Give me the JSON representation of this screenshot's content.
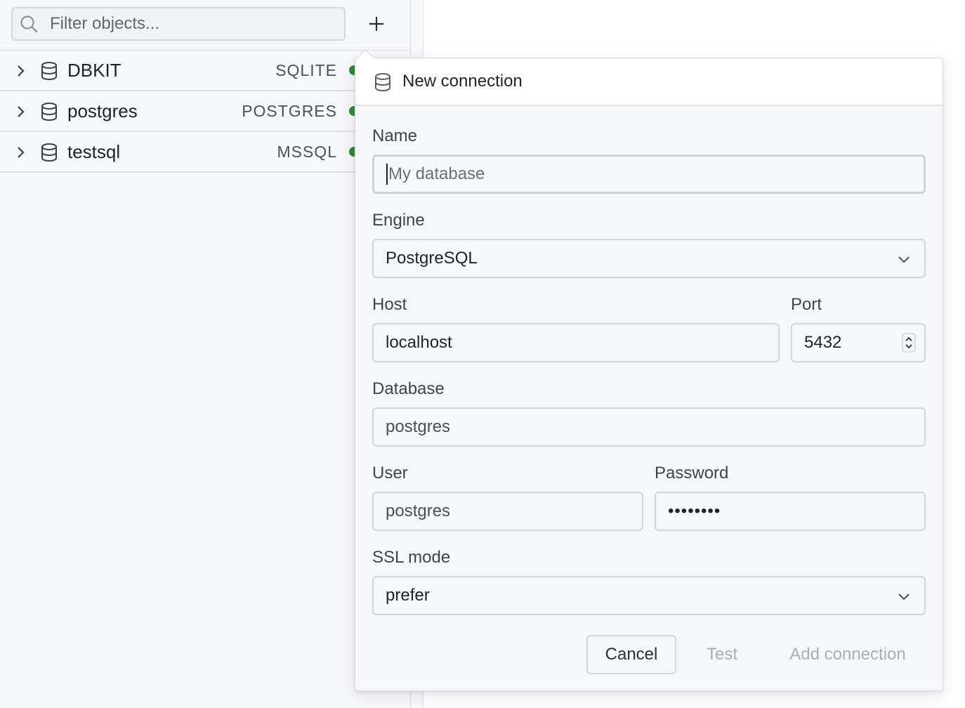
{
  "sidebar": {
    "filter": {
      "placeholder": "Filter objects..."
    },
    "add_icon": "plus-icon",
    "connections": [
      {
        "name": "DBKIT",
        "engine": "SQLITE",
        "status_color": "#2e8b3e"
      },
      {
        "name": "postgres",
        "engine": "POSTGRES",
        "status_color": "#2e8b3e"
      },
      {
        "name": "testsql",
        "engine": "MSSQL",
        "status_color": "#2e8b3e"
      }
    ]
  },
  "dialog": {
    "title": "New connection",
    "name": {
      "label": "Name",
      "placeholder": "My database",
      "value": ""
    },
    "engine": {
      "label": "Engine",
      "value": "PostgreSQL"
    },
    "host": {
      "label": "Host",
      "value": "localhost"
    },
    "port": {
      "label": "Port",
      "value": "5432"
    },
    "database": {
      "label": "Database",
      "placeholder": "postgres"
    },
    "user": {
      "label": "User",
      "placeholder": "postgres"
    },
    "password": {
      "label": "Password",
      "value": "••••••••"
    },
    "ssl": {
      "label": "SSL mode",
      "value": "prefer"
    },
    "buttons": {
      "cancel": "Cancel",
      "test": "Test",
      "add": "Add connection"
    }
  }
}
